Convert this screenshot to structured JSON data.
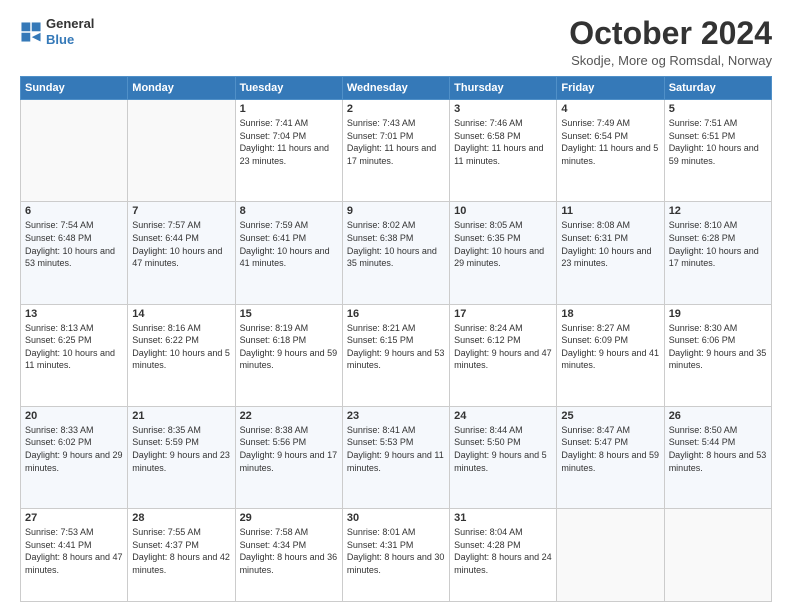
{
  "logo": {
    "line1": "General",
    "line2": "Blue"
  },
  "header": {
    "title": "October 2024",
    "subtitle": "Skodje, More og Romsdal, Norway"
  },
  "weekdays": [
    "Sunday",
    "Monday",
    "Tuesday",
    "Wednesday",
    "Thursday",
    "Friday",
    "Saturday"
  ],
  "weeks": [
    [
      {
        "day": "",
        "sunrise": "",
        "sunset": "",
        "daylight": ""
      },
      {
        "day": "",
        "sunrise": "",
        "sunset": "",
        "daylight": ""
      },
      {
        "day": "1",
        "sunrise": "Sunrise: 7:41 AM",
        "sunset": "Sunset: 7:04 PM",
        "daylight": "Daylight: 11 hours and 23 minutes."
      },
      {
        "day": "2",
        "sunrise": "Sunrise: 7:43 AM",
        "sunset": "Sunset: 7:01 PM",
        "daylight": "Daylight: 11 hours and 17 minutes."
      },
      {
        "day": "3",
        "sunrise": "Sunrise: 7:46 AM",
        "sunset": "Sunset: 6:58 PM",
        "daylight": "Daylight: 11 hours and 11 minutes."
      },
      {
        "day": "4",
        "sunrise": "Sunrise: 7:49 AM",
        "sunset": "Sunset: 6:54 PM",
        "daylight": "Daylight: 11 hours and 5 minutes."
      },
      {
        "day": "5",
        "sunrise": "Sunrise: 7:51 AM",
        "sunset": "Sunset: 6:51 PM",
        "daylight": "Daylight: 10 hours and 59 minutes."
      }
    ],
    [
      {
        "day": "6",
        "sunrise": "Sunrise: 7:54 AM",
        "sunset": "Sunset: 6:48 PM",
        "daylight": "Daylight: 10 hours and 53 minutes."
      },
      {
        "day": "7",
        "sunrise": "Sunrise: 7:57 AM",
        "sunset": "Sunset: 6:44 PM",
        "daylight": "Daylight: 10 hours and 47 minutes."
      },
      {
        "day": "8",
        "sunrise": "Sunrise: 7:59 AM",
        "sunset": "Sunset: 6:41 PM",
        "daylight": "Daylight: 10 hours and 41 minutes."
      },
      {
        "day": "9",
        "sunrise": "Sunrise: 8:02 AM",
        "sunset": "Sunset: 6:38 PM",
        "daylight": "Daylight: 10 hours and 35 minutes."
      },
      {
        "day": "10",
        "sunrise": "Sunrise: 8:05 AM",
        "sunset": "Sunset: 6:35 PM",
        "daylight": "Daylight: 10 hours and 29 minutes."
      },
      {
        "day": "11",
        "sunrise": "Sunrise: 8:08 AM",
        "sunset": "Sunset: 6:31 PM",
        "daylight": "Daylight: 10 hours and 23 minutes."
      },
      {
        "day": "12",
        "sunrise": "Sunrise: 8:10 AM",
        "sunset": "Sunset: 6:28 PM",
        "daylight": "Daylight: 10 hours and 17 minutes."
      }
    ],
    [
      {
        "day": "13",
        "sunrise": "Sunrise: 8:13 AM",
        "sunset": "Sunset: 6:25 PM",
        "daylight": "Daylight: 10 hours and 11 minutes."
      },
      {
        "day": "14",
        "sunrise": "Sunrise: 8:16 AM",
        "sunset": "Sunset: 6:22 PM",
        "daylight": "Daylight: 10 hours and 5 minutes."
      },
      {
        "day": "15",
        "sunrise": "Sunrise: 8:19 AM",
        "sunset": "Sunset: 6:18 PM",
        "daylight": "Daylight: 9 hours and 59 minutes."
      },
      {
        "day": "16",
        "sunrise": "Sunrise: 8:21 AM",
        "sunset": "Sunset: 6:15 PM",
        "daylight": "Daylight: 9 hours and 53 minutes."
      },
      {
        "day": "17",
        "sunrise": "Sunrise: 8:24 AM",
        "sunset": "Sunset: 6:12 PM",
        "daylight": "Daylight: 9 hours and 47 minutes."
      },
      {
        "day": "18",
        "sunrise": "Sunrise: 8:27 AM",
        "sunset": "Sunset: 6:09 PM",
        "daylight": "Daylight: 9 hours and 41 minutes."
      },
      {
        "day": "19",
        "sunrise": "Sunrise: 8:30 AM",
        "sunset": "Sunset: 6:06 PM",
        "daylight": "Daylight: 9 hours and 35 minutes."
      }
    ],
    [
      {
        "day": "20",
        "sunrise": "Sunrise: 8:33 AM",
        "sunset": "Sunset: 6:02 PM",
        "daylight": "Daylight: 9 hours and 29 minutes."
      },
      {
        "day": "21",
        "sunrise": "Sunrise: 8:35 AM",
        "sunset": "Sunset: 5:59 PM",
        "daylight": "Daylight: 9 hours and 23 minutes."
      },
      {
        "day": "22",
        "sunrise": "Sunrise: 8:38 AM",
        "sunset": "Sunset: 5:56 PM",
        "daylight": "Daylight: 9 hours and 17 minutes."
      },
      {
        "day": "23",
        "sunrise": "Sunrise: 8:41 AM",
        "sunset": "Sunset: 5:53 PM",
        "daylight": "Daylight: 9 hours and 11 minutes."
      },
      {
        "day": "24",
        "sunrise": "Sunrise: 8:44 AM",
        "sunset": "Sunset: 5:50 PM",
        "daylight": "Daylight: 9 hours and 5 minutes."
      },
      {
        "day": "25",
        "sunrise": "Sunrise: 8:47 AM",
        "sunset": "Sunset: 5:47 PM",
        "daylight": "Daylight: 8 hours and 59 minutes."
      },
      {
        "day": "26",
        "sunrise": "Sunrise: 8:50 AM",
        "sunset": "Sunset: 5:44 PM",
        "daylight": "Daylight: 8 hours and 53 minutes."
      }
    ],
    [
      {
        "day": "27",
        "sunrise": "Sunrise: 7:53 AM",
        "sunset": "Sunset: 4:41 PM",
        "daylight": "Daylight: 8 hours and 47 minutes."
      },
      {
        "day": "28",
        "sunrise": "Sunrise: 7:55 AM",
        "sunset": "Sunset: 4:37 PM",
        "daylight": "Daylight: 8 hours and 42 minutes."
      },
      {
        "day": "29",
        "sunrise": "Sunrise: 7:58 AM",
        "sunset": "Sunset: 4:34 PM",
        "daylight": "Daylight: 8 hours and 36 minutes."
      },
      {
        "day": "30",
        "sunrise": "Sunrise: 8:01 AM",
        "sunset": "Sunset: 4:31 PM",
        "daylight": "Daylight: 8 hours and 30 minutes."
      },
      {
        "day": "31",
        "sunrise": "Sunrise: 8:04 AM",
        "sunset": "Sunset: 4:28 PM",
        "daylight": "Daylight: 8 hours and 24 minutes."
      },
      {
        "day": "",
        "sunrise": "",
        "sunset": "",
        "daylight": ""
      },
      {
        "day": "",
        "sunrise": "",
        "sunset": "",
        "daylight": ""
      }
    ]
  ]
}
